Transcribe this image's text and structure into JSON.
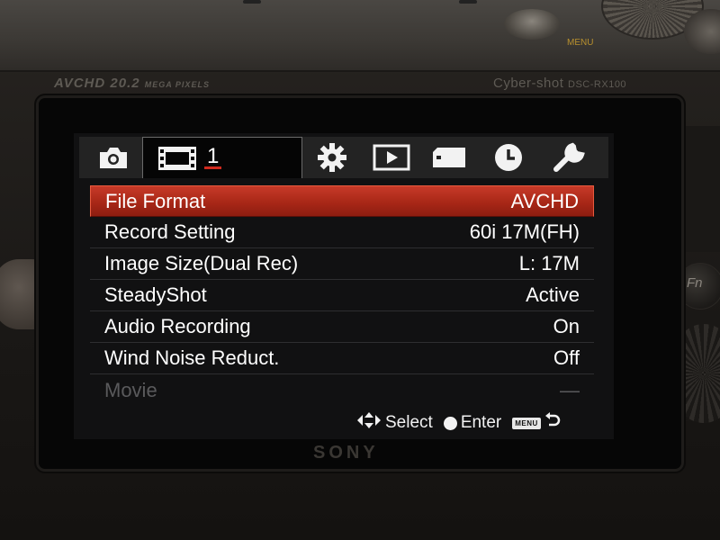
{
  "camera": {
    "brand_left": "AVCHD 20.2",
    "brand_left_sub": "MEGA PIXELS",
    "brand_right": "Cyber-shot",
    "model": "DSC-RX100",
    "dial_label": "MENU",
    "maker": "SONY",
    "fn_label": "Fn"
  },
  "tabs": [
    {
      "icon": "camera-icon",
      "label": ""
    },
    {
      "icon": "movie-icon",
      "label": "1"
    },
    {
      "icon": "gear-icon",
      "label": ""
    },
    {
      "icon": "playback-icon",
      "label": ""
    },
    {
      "icon": "memory-card-icon",
      "label": ""
    },
    {
      "icon": "clock-icon",
      "label": ""
    },
    {
      "icon": "wrench-icon",
      "label": ""
    }
  ],
  "menu": {
    "items": [
      {
        "label": "File Format",
        "value": "AVCHD",
        "state": "selected"
      },
      {
        "label": "Record Setting",
        "value": "60i 17M(FH)",
        "state": "normal"
      },
      {
        "label": "Image Size(Dual Rec)",
        "value": "L: 17M",
        "state": "normal"
      },
      {
        "label": "SteadyShot",
        "value": "Active",
        "state": "normal"
      },
      {
        "label": "Audio Recording",
        "value": "On",
        "state": "normal"
      },
      {
        "label": "Wind Noise Reduct.",
        "value": "Off",
        "state": "normal"
      },
      {
        "label": "Movie",
        "value": "—",
        "state": "disabled"
      }
    ]
  },
  "guide": {
    "select_label": "Select",
    "enter_label": "Enter",
    "menu_chip": "MENU",
    "accent_selected": "#b22a1a"
  }
}
